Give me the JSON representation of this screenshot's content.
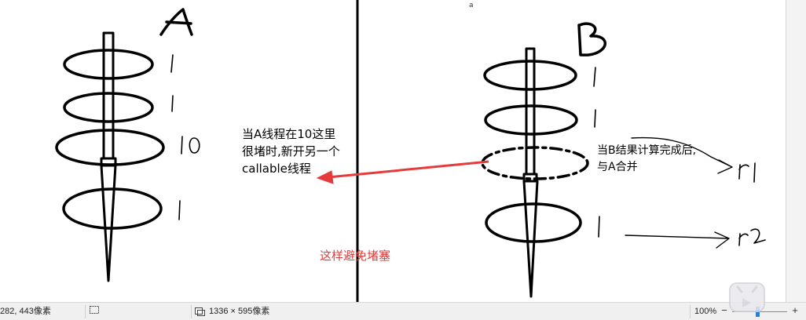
{
  "canvas": {
    "label_a": "A",
    "label_b": "B",
    "small_mark": "a",
    "left_marks": [
      "1",
      "1",
      "10",
      "1"
    ],
    "right_marks": [
      "1",
      "1",
      "r1",
      "1",
      "r2"
    ],
    "note_left": "当A线程在10这里\n很堵时,新开另一个\ncallable线程",
    "note_right": "当B结果计算完成后,\n与A合并",
    "note_red": "这样避免堵塞",
    "colors": {
      "ink": "#000000",
      "arrow": "#e53b3b",
      "note_red": "#e23b3b"
    }
  },
  "status_bar": {
    "coordinates": "282, 443像素",
    "canvas_size": "1336 × 595像素",
    "zoom": "100%",
    "icons": [
      "selection-icon",
      "canvas-size-icon",
      "zoom-minus-icon",
      "zoom-plus-icon"
    ]
  }
}
